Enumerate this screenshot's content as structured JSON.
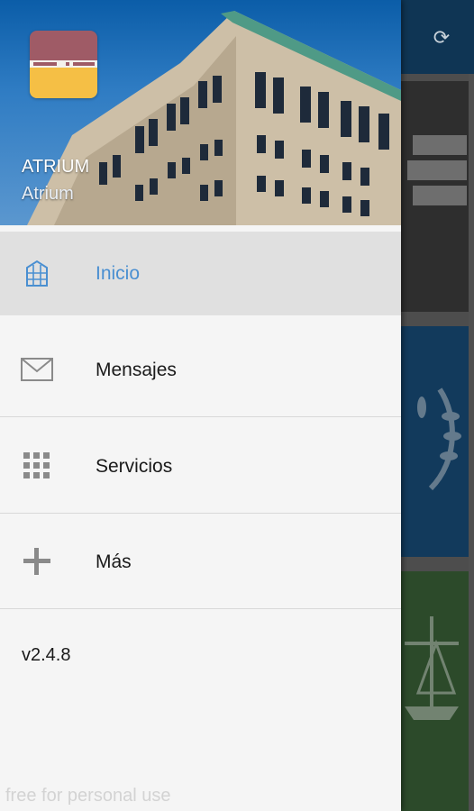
{
  "header": {
    "title": "ATRIUM",
    "subtitle": "Atrium"
  },
  "menu": {
    "items": [
      {
        "label": "Inicio",
        "icon": "building-icon",
        "active": true
      },
      {
        "label": "Mensajes",
        "icon": "envelope-icon",
        "active": false
      },
      {
        "label": "Servicios",
        "icon": "grid-icon",
        "active": false
      },
      {
        "label": "Más",
        "icon": "plus-icon",
        "active": false
      }
    ]
  },
  "version": "v2.4.8",
  "watermark": "free for personal use",
  "colors": {
    "active_accent": "#4a8fd1",
    "topbar": "#0f3554",
    "logo_top": "#9f5b66",
    "logo_bottom": "#f5bf45"
  }
}
